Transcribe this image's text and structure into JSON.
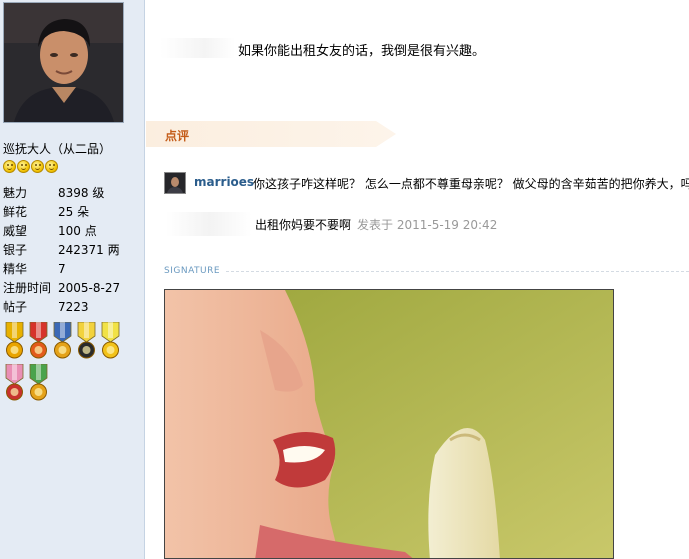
{
  "profile": {
    "rank_title": "巡抚大人（从二品）",
    "emoticons": [
      "smiley-icon",
      "smiley-icon",
      "smiley-icon",
      "smiley-icon"
    ],
    "stats": [
      {
        "label": "魅力",
        "value": "8398 级"
      },
      {
        "label": "鲜花",
        "value": "25 朵"
      },
      {
        "label": "威望",
        "value": "100 点"
      },
      {
        "label": "银子",
        "value": "242371 两"
      },
      {
        "label": "精华",
        "value": "7"
      },
      {
        "label": "注册时间",
        "value": "2005-8-27"
      },
      {
        "label": "帖子",
        "value": "7223"
      }
    ],
    "medals": [
      {
        "ribbon": "#e8b100",
        "medal": "#e9a400"
      },
      {
        "ribbon": "#d6332b",
        "medal": "#e25a1c"
      },
      {
        "ribbon": "#3b69b6",
        "medal": "#e4a21a"
      },
      {
        "ribbon": "#f2d23d",
        "medal": "#2b2b2b"
      },
      {
        "ribbon": "#f1e246",
        "medal": "#f2c21a"
      },
      {
        "ribbon": "#e98fb5",
        "medal": "#c7312d"
      },
      {
        "ribbon": "#4aa34c",
        "medal": "#e4a21a"
      }
    ]
  },
  "post": {
    "quote_text": "如果你能出租女友的话，我倒是很有兴趣。"
  },
  "review": {
    "label": "点评",
    "username": "marrioes",
    "comment": "你这孩子咋这样呢？ 怎么一点都不尊重母亲呢？ 做父母的含辛茹苦的把你养大，吗",
    "reply_text": "出租你妈要不要啊",
    "reply_time": "发表于 2011-5-19 20:42"
  },
  "signature": {
    "label": "SIGNATURE"
  },
  "colors": {
    "sidebar_bg": "#e4ebf4",
    "review_accent": "#c45c19",
    "username": "#2b5d8c",
    "signature_label": "#6b9ac0"
  }
}
